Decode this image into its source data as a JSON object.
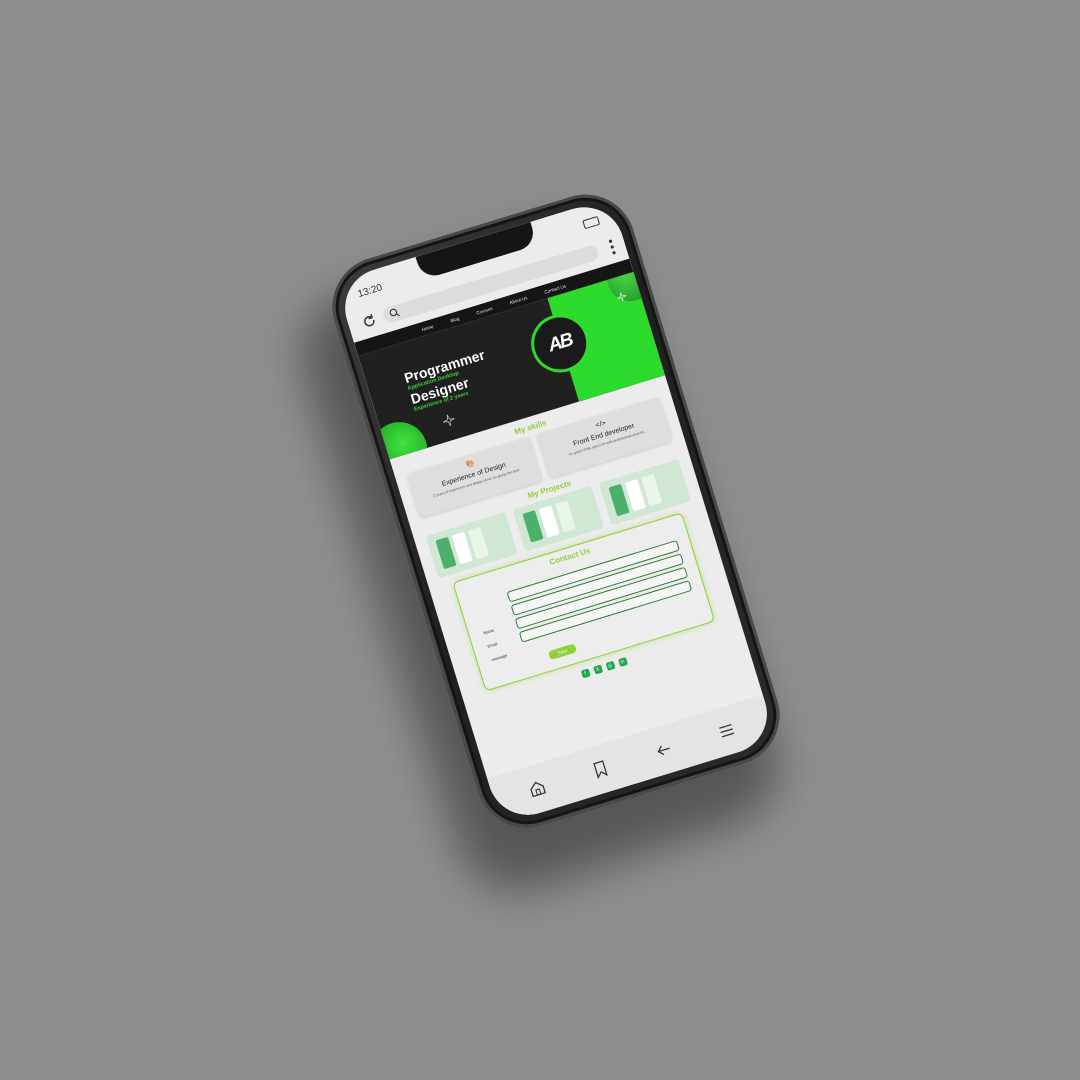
{
  "status": {
    "time": "13:20"
  },
  "nav": {
    "items": [
      "Home",
      "Blog",
      "Courses",
      "About Us",
      "Contact Us"
    ]
  },
  "hero": {
    "line1": "Programmer",
    "sub1": "Application Desktop",
    "line2": "Designer",
    "sub2": "Experience of 2 years",
    "logo_text": "AB"
  },
  "skills": {
    "title": "My skills",
    "cards": [
      {
        "icon": "palette-icon",
        "glyph": "🎨",
        "title": "Experience of Design",
        "desc": "2 years of experience and always strive for giving the best"
      },
      {
        "icon": "code-icon",
        "glyph": "</>",
        "title": "Front End developer",
        "desc": "I'm good HTML and CSS with professional projects"
      }
    ]
  },
  "projects": {
    "title": "My Projects",
    "count": 3
  },
  "contact": {
    "title": "Contact Us",
    "labels": {
      "name": "Name",
      "email": "Email",
      "message": "message"
    },
    "send_label": "Send"
  },
  "socials": [
    "facebook-icon",
    "x-icon",
    "instagram-icon",
    "linkedin-icon"
  ],
  "bottom_nav": [
    "home-icon",
    "bookmark-icon",
    "back-arrow-icon",
    "menu-icon"
  ],
  "colors": {
    "accent_green": "#2ddb2d",
    "section_title": "#8ed13a",
    "background": "#8e8e8e"
  }
}
